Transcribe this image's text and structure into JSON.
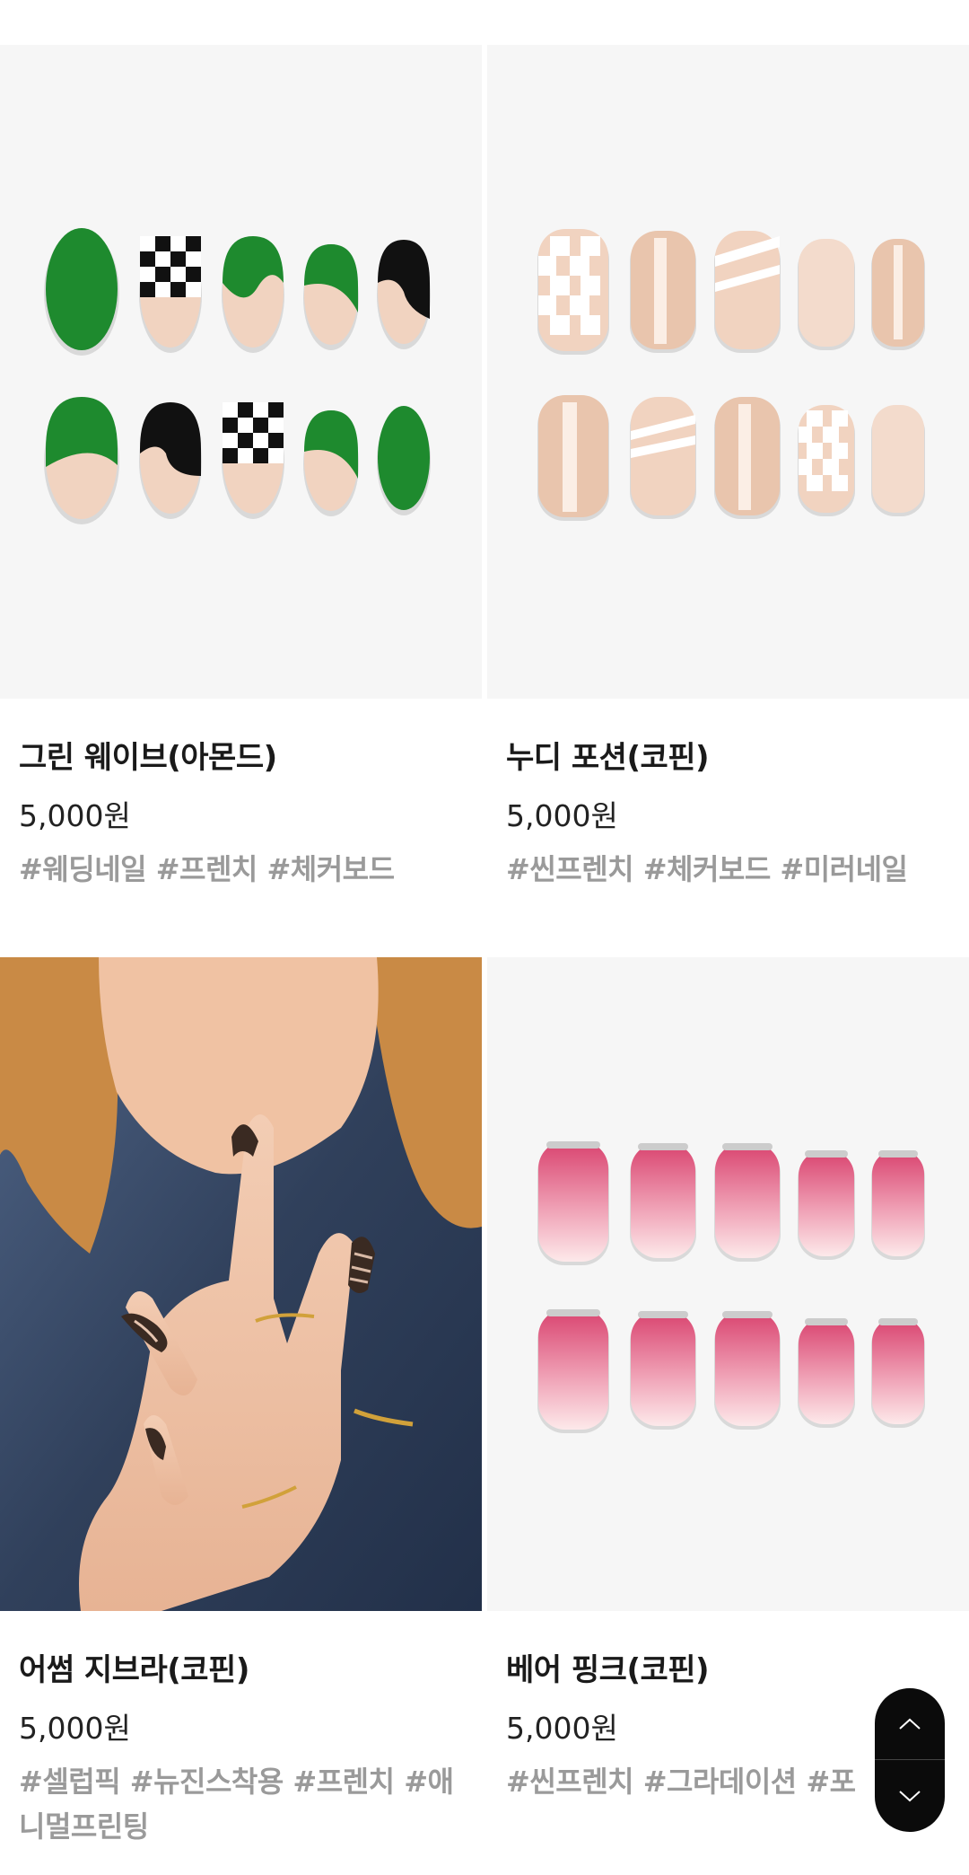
{
  "products": [
    {
      "name": "그린 웨이브(아몬드)",
      "price": "5,000원",
      "tags": "#웨딩네일 #프렌치 #체커보드"
    },
    {
      "name": "누디 포션(코핀)",
      "price": "5,000원",
      "tags": "#씬프렌치 #체커보드 #미러네일"
    },
    {
      "name": "어썸 지브라(코핀)",
      "price": "5,000원",
      "tags": "#셀럽픽 #뉴진스착용 #프렌치 #애니멀프린팅"
    },
    {
      "name": "베어 핑크(코핀)",
      "price": "5,000원",
      "tags": "#씬프렌치 #그라데이션 #포"
    }
  ],
  "scroll_control": {
    "up_icon": "chevron-up-icon",
    "down_icon": "chevron-down-icon"
  },
  "colors": {
    "green": "#1e8a2e",
    "nude": "#f1d3c0",
    "pink": "#e0517c",
    "control_bg": "#0b0b0b"
  }
}
